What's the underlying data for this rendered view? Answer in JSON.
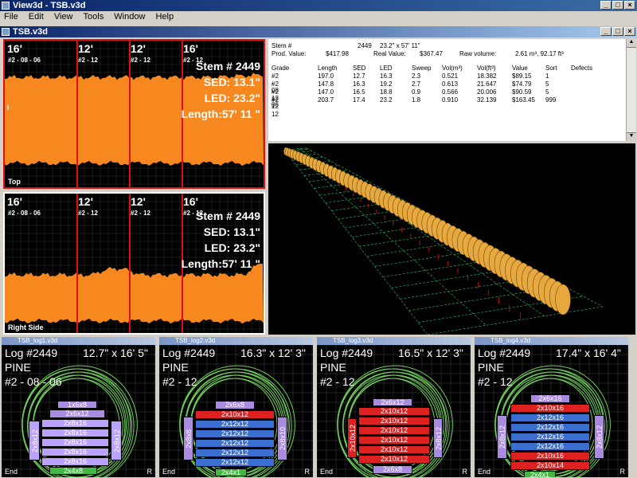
{
  "app": {
    "title": "View3d - TSB.v3d",
    "win_btns": [
      "_",
      "□",
      "×"
    ]
  },
  "menu": [
    "File",
    "Edit",
    "View",
    "Tools",
    "Window",
    "Help"
  ],
  "doc": {
    "title": "TSB.v3d",
    "win_btns": [
      "_",
      "□",
      "×"
    ]
  },
  "top_plot": {
    "corner_label": "Top",
    "segments": [
      {
        "length": "16'",
        "grade": "#2 - 08 - 06"
      },
      {
        "length": "12'",
        "grade": "#2 - 12"
      },
      {
        "length": "12'",
        "grade": "#2 - 12"
      },
      {
        "length": "16'",
        "grade": "#2 - 12"
      }
    ],
    "stem": "Stem # 2449",
    "sed": "SED: 13.1\"",
    "led": "LED: 23.2\"",
    "length": "Length:57' 11 \"",
    "extra_label": "I"
  },
  "side_plot": {
    "corner_label": "Right Side",
    "segments": [
      {
        "length": "16'",
        "grade": "#2 - 08 - 06"
      },
      {
        "length": "12'",
        "grade": "#2 - 12"
      },
      {
        "length": "12'",
        "grade": "#2 - 12"
      },
      {
        "length": "16'",
        "grade": "#2 - 12"
      }
    ],
    "stem": "Stem # 2449",
    "sed": "SED: 13.1\"",
    "led": "LED: 23.2\"",
    "length": "Length:57' 11 \""
  },
  "info": {
    "stem_label": "Stem #",
    "stem_value": "2449",
    "stem_dims": "23.2\" x 57' 11\"",
    "prod_label": "Prod. Value:",
    "prod_value": "$417.98",
    "real_label": "Real Value:",
    "real_value": "$367.47",
    "raw_label": "Raw volume:",
    "raw_value": "2.61 m³, 92.17 ft³",
    "columns": [
      "Grade",
      "Length",
      "SED",
      "LED",
      "Sweep",
      "Vol(m³)",
      "Vol(ft³)",
      "Value",
      "Sort",
      "Defects"
    ],
    "rows": [
      [
        "#2 - 08 - 06",
        "197.0",
        "12.7",
        "16.3",
        "2.3",
        "0.521",
        "18.382",
        "$89.15",
        "1",
        ""
      ],
      [
        "#2 - 12",
        "147.8",
        "16.3",
        "19.2",
        "2.7",
        "0.613",
        "21.647",
        "$74.79",
        "5",
        ""
      ],
      [
        "#2 - 12",
        "147.0",
        "16.5",
        "18.8",
        "0.9",
        "0.566",
        "20.006",
        "$90.59",
        "5",
        ""
      ],
      [
        "#2 - 12",
        "203.7",
        "17.4",
        "23.2",
        "1.8",
        "0.910",
        "32.139",
        "$163.45",
        "999",
        ""
      ]
    ]
  },
  "logs": [
    {
      "win_title": "TSB_log1.v3d",
      "log": "Log #2449",
      "dims": "12.7\" x 16' 5\"",
      "species": "PINE",
      "grade": "#2 - 08 - 06",
      "boards": [
        "1x6x8",
        "2x6x12",
        "2x8x16",
        "2x8x16",
        "2x8x16",
        "2x8x16",
        "2x8x16",
        "2x4x8",
        "2x8x12",
        "2x8x12"
      ],
      "corner_l": "End",
      "corner_r": "R"
    },
    {
      "win_title": "TSB_log2.v3d",
      "log": "Log #2449",
      "dims": "16.3\" x 12' 3\"",
      "species": "PINE",
      "grade": "#2 - 12",
      "boards": [
        "2x6x8",
        "2x10x12",
        "2x12x12",
        "2x12x12",
        "2x12x12",
        "2x12x12",
        "2x12x12",
        "2x4x1",
        "2x8x8",
        "2x8x10"
      ],
      "corner_l": "End",
      "corner_r": "R"
    },
    {
      "win_title": "TSB_log3.v3d",
      "log": "Log #2449",
      "dims": "16.5\" x 12' 3\"",
      "species": "PINE",
      "grade": "#2 - 12",
      "boards": [
        "2x6x12",
        "2x10x12",
        "2x10x12",
        "2x10x12",
        "2x10x12",
        "2x10x12",
        "2x10x12",
        "2x6x8",
        "2x10x12",
        "2x8x12"
      ],
      "corner_l": "End",
      "corner_r": "R"
    },
    {
      "win_title": "TSB_log4.v3d",
      "log": "Log #2449",
      "dims": "17.4\" x 16' 4\"",
      "species": "PINE",
      "grade": "#2 - 12",
      "boards": [
        "2x6x16",
        "2x10x16",
        "2x12x16",
        "2x12x16",
        "2x12x16",
        "2x12x16",
        "2x10x16",
        "2x10x14",
        "2x4x1",
        "2x8x12",
        "2x8x12"
      ],
      "corner_l": "End",
      "corner_r": "R"
    }
  ],
  "colors": {
    "profile": "#f7871f",
    "cut_line": "#e01010",
    "tree": "#e8a840",
    "grid3d": "#2fbf6b",
    "ring": "#6fd05a"
  }
}
